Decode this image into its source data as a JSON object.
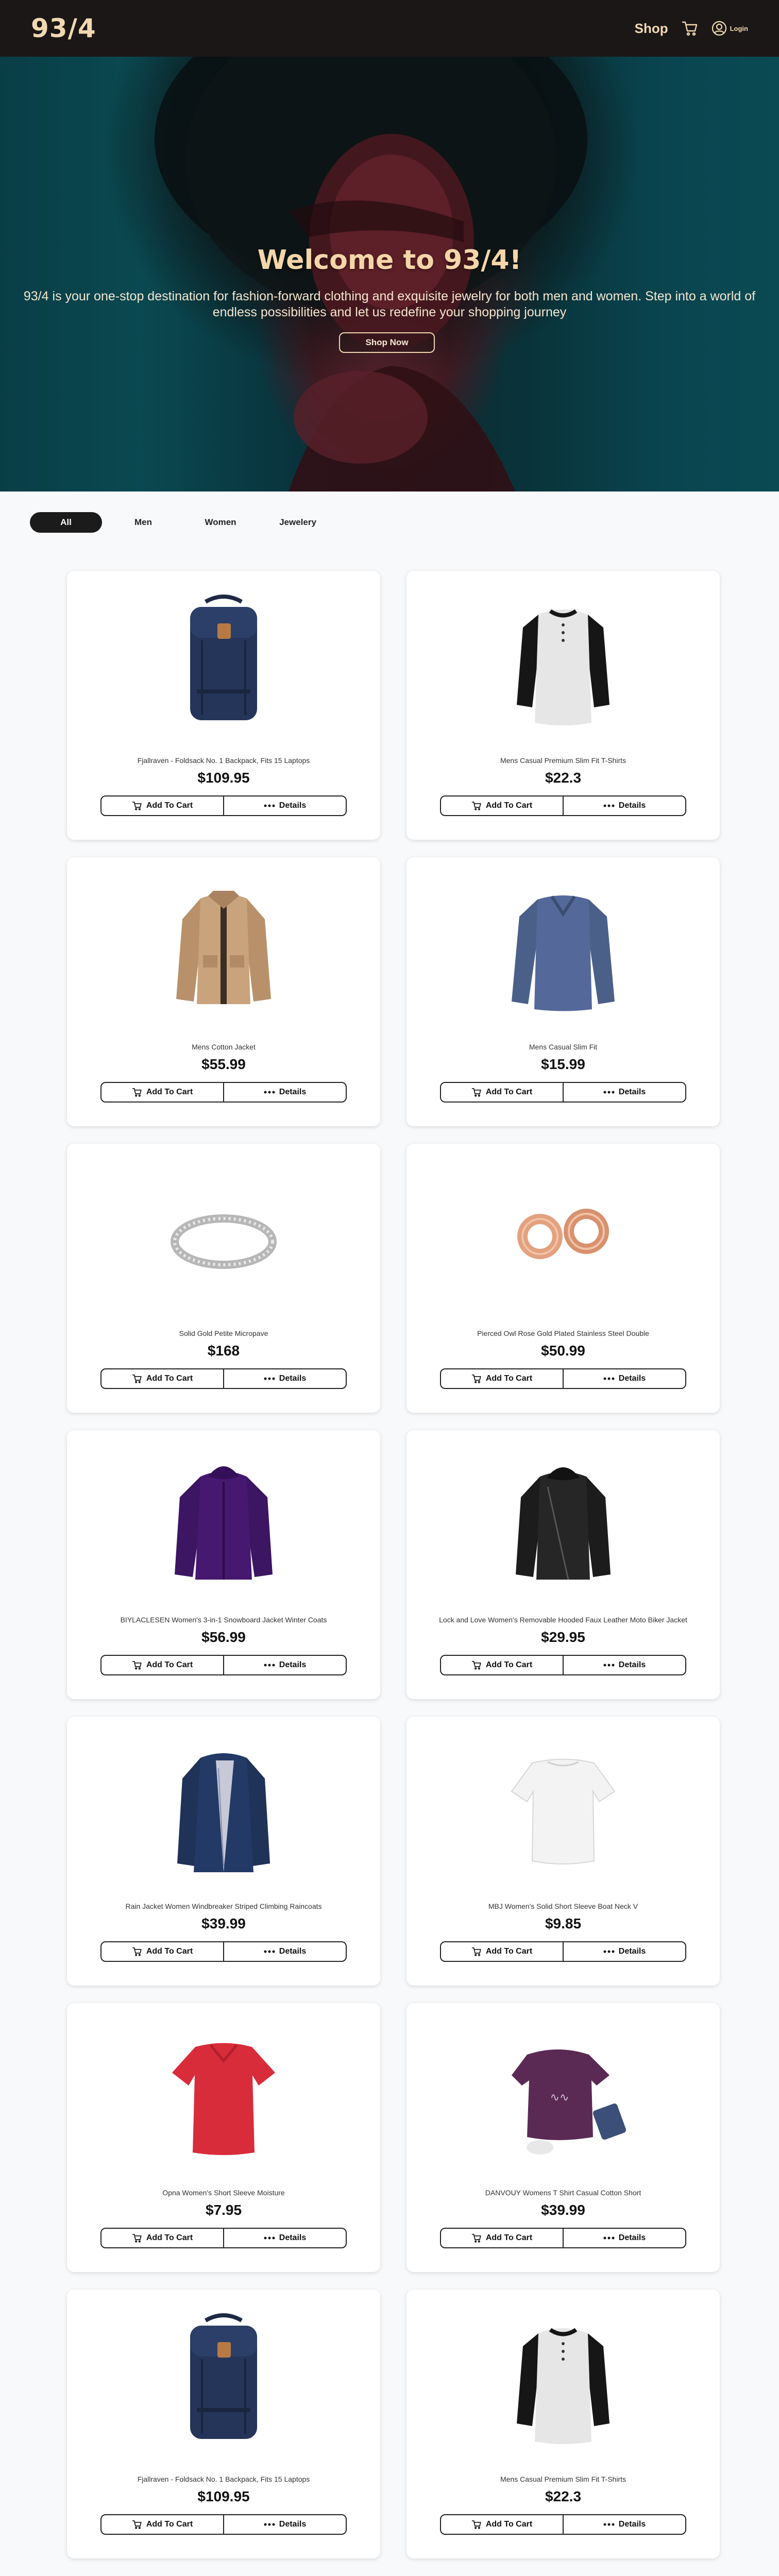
{
  "header": {
    "logo": "93/4",
    "shop_label": "Shop",
    "login_label": "Login"
  },
  "hero": {
    "title": "Welcome to 93/4!",
    "text": "93/4 is your one-stop destination for fashion-forward clothing and exquisite jewelry for both men and women. Step into a world of endless possibilities and let us redefine your shopping journey",
    "button": "Shop Now"
  },
  "filters": [
    "All",
    "Men",
    "Women",
    "Jewelery"
  ],
  "active_filter": "All",
  "colors": {
    "header_bg": "#1b1716",
    "accent": "#f1d8b0",
    "page_bg": "#f8f9fb",
    "dark_button": "#1b1b1b"
  },
  "buttons": {
    "add_to_cart": "Add To Cart",
    "details": "Details"
  },
  "products": [
    {
      "title": "Fjallraven - Foldsack No. 1 Backpack, Fits 15 Laptops",
      "price": "$109.95",
      "image": "backpack"
    },
    {
      "title": "Mens Casual Premium Slim Fit T-Shirts",
      "price": "$22.3",
      "image": "henley-shirt"
    },
    {
      "title": "Mens Cotton Jacket",
      "price": "$55.99",
      "image": "cotton-jacket"
    },
    {
      "title": "Mens Casual Slim Fit",
      "price": "$15.99",
      "image": "blue-longsleeve"
    },
    {
      "title": "Solid Gold Petite Micropave",
      "price": "$168",
      "image": "silver-ring"
    },
    {
      "title": "Pierced Owl Rose Gold Plated Stainless Steel Double",
      "price": "$50.99",
      "image": "rose-gold-tunnels"
    },
    {
      "title": "BIYLACLESEN Women's 3-in-1 Snowboard Jacket Winter Coats",
      "price": "$56.99",
      "image": "purple-jacket"
    },
    {
      "title": "Lock and Love Women's Removable Hooded Faux Leather Moto Biker Jacket",
      "price": "$29.95",
      "image": "leather-jacket"
    },
    {
      "title": "Rain Jacket Women Windbreaker Striped Climbing Raincoats",
      "price": "$39.99",
      "image": "navy-raincoat"
    },
    {
      "title": "MBJ Women's Solid Short Sleeve Boat Neck V",
      "price": "$9.85",
      "image": "white-top"
    },
    {
      "title": "Opna Women's Short Sleeve Moisture",
      "price": "$7.95",
      "image": "red-tshirt"
    },
    {
      "title": "DANVOUY Womens T Shirt Casual Cotton Short",
      "price": "$39.99",
      "image": "purple-tshirt"
    },
    {
      "title": "Fjallraven - Foldsack No. 1 Backpack, Fits 15 Laptops",
      "price": "$109.95",
      "image": "backpack"
    },
    {
      "title": "Mens Casual Premium Slim Fit T-Shirts",
      "price": "$22.3",
      "image": "henley-shirt"
    }
  ]
}
